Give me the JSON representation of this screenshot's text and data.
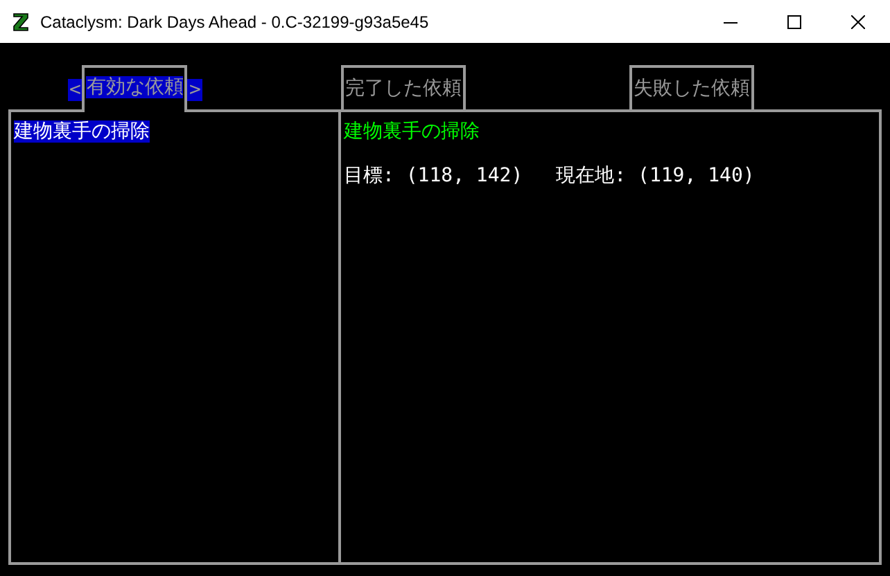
{
  "window": {
    "title": "Cataclysm: Dark Days Ahead - 0.C-32199-g93a5e45"
  },
  "tab_arrows": {
    "prev": "<",
    "next": ">"
  },
  "tabs": [
    {
      "label": "有効な依頼",
      "selected": true
    },
    {
      "label": "完了した依頼",
      "selected": false
    },
    {
      "label": "失敗した依頼",
      "selected": false
    }
  ],
  "missions": [
    {
      "name": "建物裏手の掃除",
      "selected": true
    }
  ],
  "details": {
    "title": "建物裏手の掃除",
    "target": "目標: (118, 142)",
    "location": "現在地: (119, 140)"
  }
}
